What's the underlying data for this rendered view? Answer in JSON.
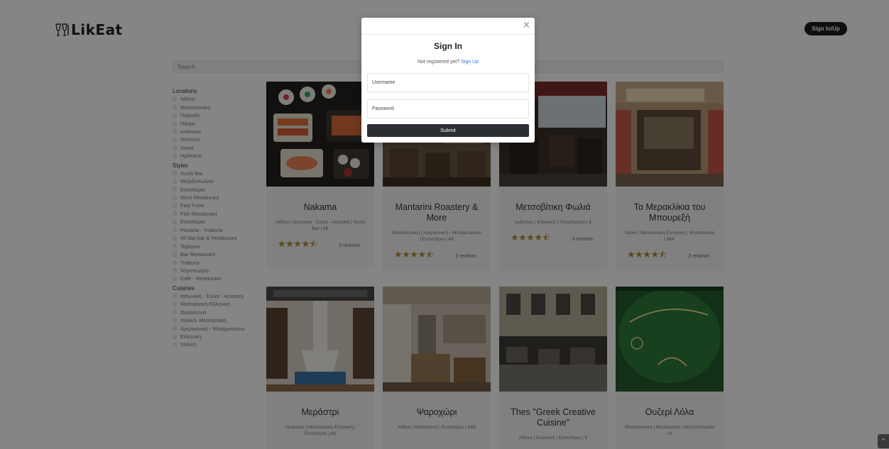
{
  "header": {
    "logo_text": "LikEat",
    "signin_button": "Sign In/Up"
  },
  "search": {
    "placeholder": "Search"
  },
  "sidebar": {
    "locations_title": "Locations",
    "locations": [
      "Αθήνα",
      "Θεσσαλονίκη",
      "Πειραιάς",
      "Πάτρα",
      "Ιωάννινα",
      "Ναύπλιο",
      "Χανιά",
      "Ηράκλειο"
    ],
    "styles_title": "Styles",
    "styles": [
      "Sushi Bar",
      "Μεζεδοπωλείο",
      "Εστιατόριο",
      "Wine Restaurant",
      "Fast Food",
      "Fish Restaurant",
      "Εστιατόριο",
      "Pizzaria - Trattoria",
      "All day bar & Restaurant",
      "Ταβέρνα",
      "Bar Restaurant",
      "Trattoria",
      "Ψητοπωλείο",
      "Cafe - Restaurant"
    ],
    "cuisines_title": "Cuisines",
    "cuisines": [
      "Ιαπωνική - Σούσι - Ασιατική",
      "Μεσογειακή-Ελληνική",
      "Θαλασσινά",
      "Ιταλική- Μεσογειακή",
      "Αμερικανική - Μπάρμπεκιου",
      "Ελληνική",
      "Ιταλική"
    ]
  },
  "restaurants": [
    {
      "name": "Nakama",
      "meta": "Αθήνα | Ιαπωνική - Σούσι - Ασιατική | Sushi Bar | €€",
      "rating": 4.5,
      "stars": "★★★★⯪",
      "reviews": "3 reviews",
      "image": "sushi-platter-image"
    },
    {
      "name": "Mantarini Roastery & More",
      "meta": "Θεσσαλονίκη | Αμερικανική - Μπάρμπεκιου | Εστιατόριο | €€",
      "rating": 4.5,
      "stars": "★★★★⯪",
      "reviews": "3 reviews",
      "image": "restaurant-interior-image"
    },
    {
      "name": "Μετσοβίτικη Φωλιά",
      "meta": "Ιωάννινα | Ελληνική | Ψητοπωλείο | €",
      "rating": 4.5,
      "stars": "★★★★⯪",
      "reviews": "3 reviews",
      "image": "dining-room-image"
    },
    {
      "name": "Τα Μερακλίκια του Μπουρεξή",
      "meta": "Χανιά | Μεσογειακή-Ελληνική | Ψητοπωλείο | €€€",
      "rating": 4.5,
      "stars": "★★★★⯪",
      "reviews": "3 reviews",
      "image": "storefront-image"
    },
    {
      "name": "Μεράστρι",
      "meta": "Ηράκλειο | Μεσογειακή-Ελληνική | Εστιατόριο | €€",
      "image": "fireplace-interior-image"
    },
    {
      "name": "Ψαροχώρι",
      "meta": "Αθήνα | Θαλασσινά | Εστιατόριο | €€€",
      "image": "fish-restaurant-interior-image"
    },
    {
      "name": "Thes \"Greek Creative Cuisine\"",
      "meta": "Αθήνα | Ελληνική | Εστιατόριο | €",
      "image": "outdoor-terrace-image"
    },
    {
      "name": "Ουζερί Λόλα",
      "meta": "Θεσσαλονίκη | Μεσογειακή | Μεζεδοπωλείο | €",
      "image": "green-sign-image"
    }
  ],
  "modal": {
    "title": "Sign In",
    "not_registered": "Not registered yet?",
    "signup_link": "Sign Up",
    "username_placeholder": "Username",
    "password_placeholder": "Password",
    "submit": "Submit",
    "close_symbol": "×"
  },
  "scroll_top_symbol": "^"
}
